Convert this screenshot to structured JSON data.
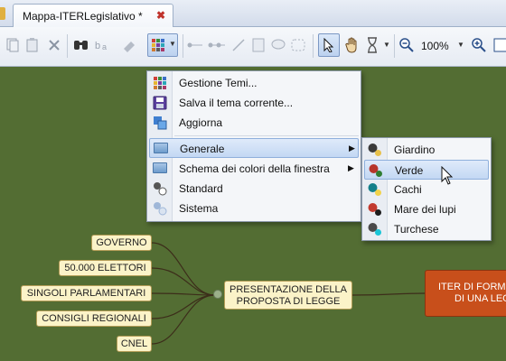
{
  "tabs": {
    "title": "Mappa-ITERLegislativo *",
    "close": "✖"
  },
  "toolbar": {
    "zoom": "100%"
  },
  "theme_menu": {
    "items": [
      {
        "label": "Gestione Temi...",
        "icon": "themes-grid-icon"
      },
      {
        "label": "Salva il tema corrente...",
        "icon": "save-icon"
      },
      {
        "label": "Aggiorna",
        "icon": "refresh-icon"
      },
      {
        "label": "Generale",
        "icon": "folder-icon",
        "submenu": true,
        "highlighted": true
      },
      {
        "label": "Schema dei colori della finestra",
        "icon": "folder-icon",
        "submenu": true
      },
      {
        "label": "Standard",
        "icon": "standard-theme-icon"
      },
      {
        "label": "Sistema",
        "icon": "system-theme-icon"
      }
    ]
  },
  "submenu": {
    "items": [
      {
        "label": "Giardino",
        "colors": [
          "#3a3a3a",
          "#e8c14a"
        ]
      },
      {
        "label": "Verde",
        "colors": [
          "#b7352b",
          "#2f7d32"
        ],
        "highlighted": true
      },
      {
        "label": "Cachi",
        "colors": [
          "#137f8a",
          "#f1d24a"
        ]
      },
      {
        "label": "Mare dei lupi",
        "colors": [
          "#c23a2f",
          "#1b1b1b"
        ]
      },
      {
        "label": "Turchese",
        "colors": [
          "#4a4a4a",
          "#19c5d6"
        ]
      }
    ]
  },
  "map": {
    "left_nodes": [
      "GOVERNO",
      "50.000 ELETTORI",
      "SINGOLI PARLAMENTARI",
      "CONSIGLI REGIONALI",
      "CNEL"
    ],
    "central": [
      "PRESENTAZIONE DELLA",
      "PROPOSTA DI LEGGE"
    ],
    "right": [
      "ITER DI FORM",
      "DI UNA LEG"
    ],
    "colors": {
      "background": "#536d33",
      "node_fill": "#fbf3c8",
      "right_fill": "#c84f1b"
    }
  }
}
